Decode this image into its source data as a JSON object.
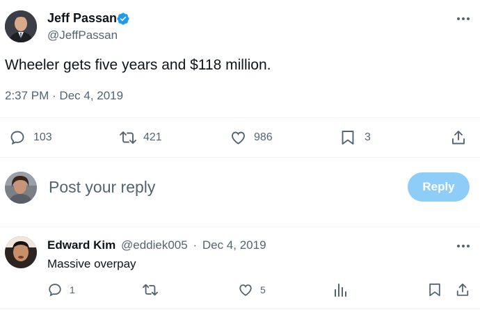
{
  "tweet": {
    "author_name": "Jeff Passan",
    "author_handle": "@JeffPassan",
    "text": "Wheeler gets five years and $118 million.",
    "timestamp": "2:37 PM · Dec 4, 2019",
    "stats": {
      "replies": "103",
      "retweets": "421",
      "likes": "986",
      "bookmarks": "3"
    }
  },
  "composer": {
    "placeholder": "Post your reply",
    "reply_button": "Reply"
  },
  "reply": {
    "author_name": "Edward Kim",
    "author_handle": "@eddiek005",
    "separator": "·",
    "date": "Dec 4, 2019",
    "text": "Massive overpay",
    "stats": {
      "replies": "1",
      "likes": "5"
    }
  },
  "colors": {
    "verified": "#1d9bf0",
    "reply_button_bg": "#8ecdf8",
    "text_primary": "#0f1419",
    "text_muted": "#536471"
  }
}
